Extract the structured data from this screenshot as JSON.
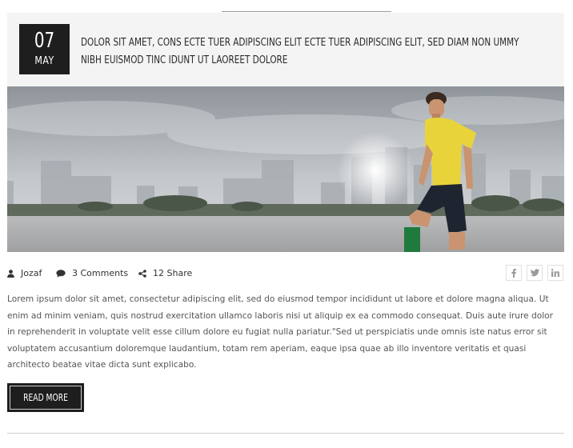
{
  "post": {
    "date": {
      "day": "07",
      "month": "MAY"
    },
    "title_lines": [
      "DOLOR SIT AMET, CONS ECTE TUER ADIPISCING ELIT ECTE TUER ADIPISCING ELIT, SED DIAM NON UMMY",
      "NIBH EUISMOD TINC IDUNT UT LAOREET DOLORE"
    ],
    "meta": {
      "author": "Jozaf",
      "comments": "3 Comments",
      "shares": "12 Share"
    },
    "social_icons": [
      "facebook-icon",
      "twitter-icon",
      "linkedin-icon"
    ],
    "excerpt_lines": [
      "Lorem ipsum dolor sit amet, consectetur adipiscing elit, sed do eiusmod tempor incididunt ut labore et dolore magna aliqua. Ut",
      "enim ad minim veniam, quis nostrud exercitation ullamco laboris nisi ut aliquip ex ea commodo consequat. Duis aute irure dolor",
      "in reprehenderit in voluptate velit esse cillum dolore eu fugiat nulla pariatur.\"Sed ut perspiciatis unde omnis iste natus error sit",
      "voluptatem accusantium doloremque laudantium, totam rem aperiam, eaque ipsa quae ab illo inventore veritatis et quasi",
      "architecto beatae vitae dicta sunt explicabo."
    ],
    "read_more_label": "READ MORE"
  },
  "colors": {
    "dark": "#1e1e1e",
    "header_bg": "#f4f4f4",
    "jersey": "#e8d43a"
  }
}
